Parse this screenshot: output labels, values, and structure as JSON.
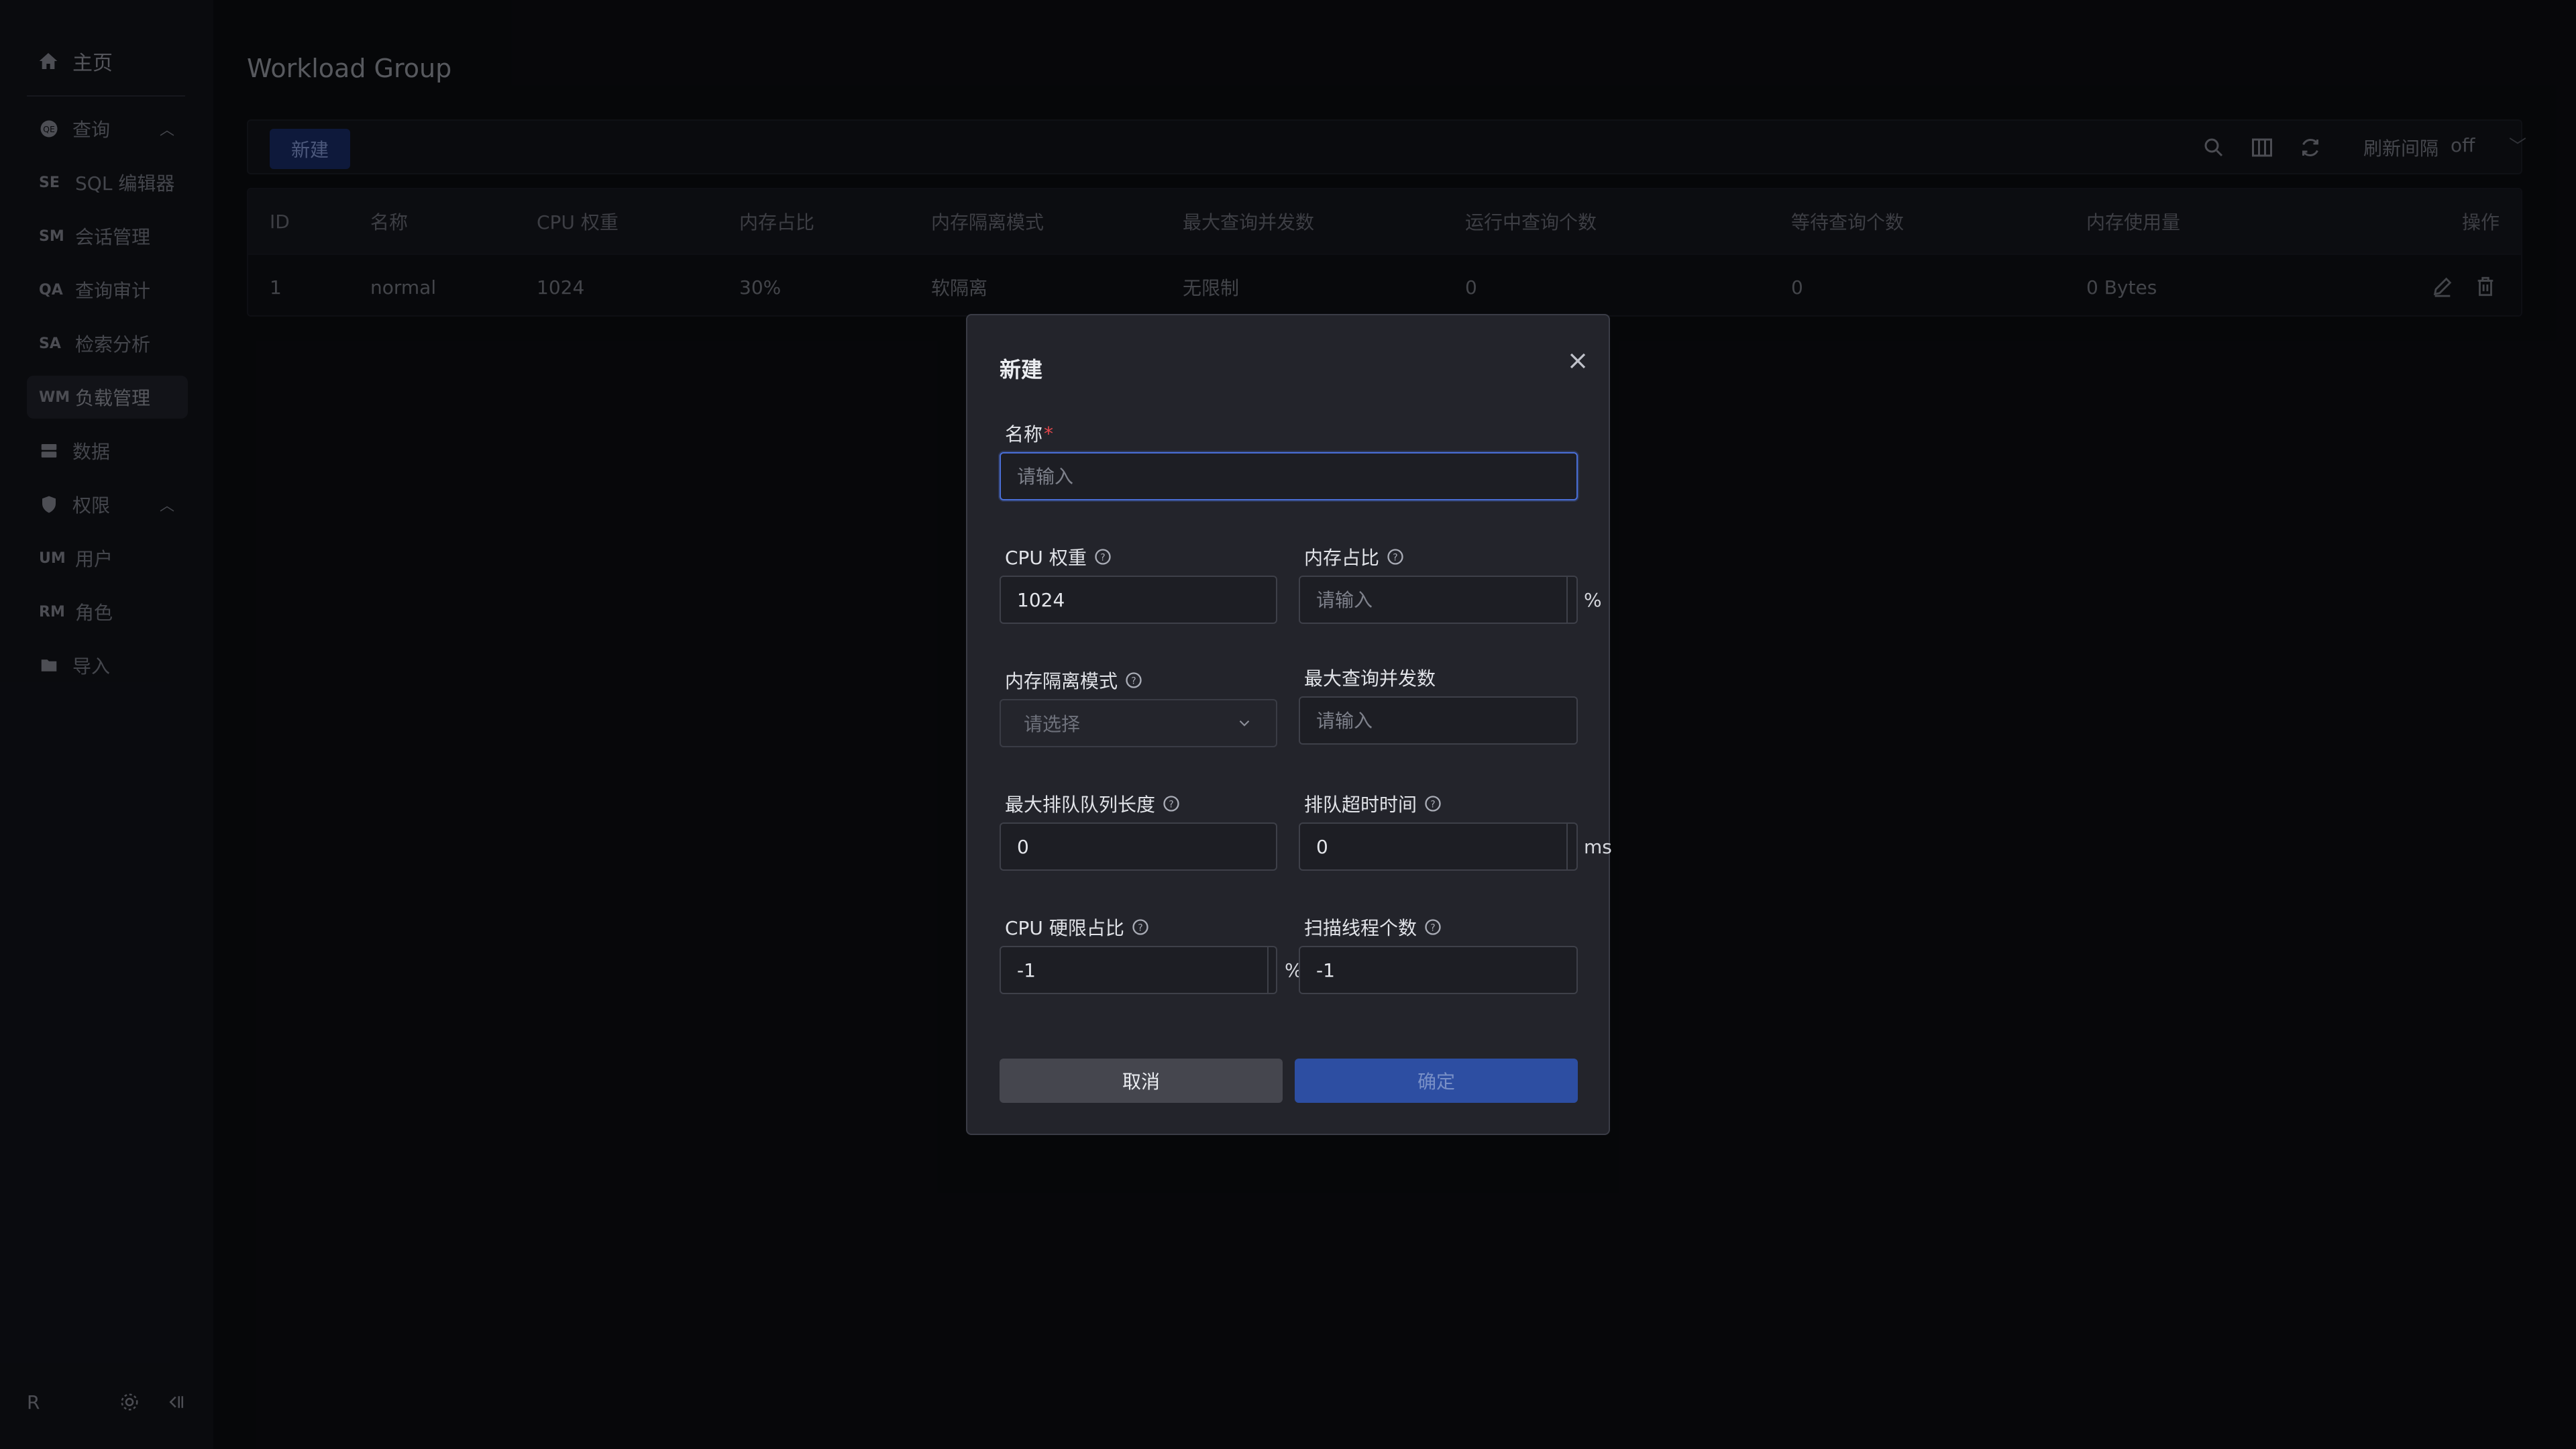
{
  "sidebar": {
    "home": "主页",
    "query_group": "查询",
    "items": [
      {
        "abbr": "SE",
        "label": "SQL 编辑器"
      },
      {
        "abbr": "SM",
        "label": "会话管理"
      },
      {
        "abbr": "QA",
        "label": "查询审计"
      },
      {
        "abbr": "SA",
        "label": "检索分析"
      },
      {
        "abbr": "WM",
        "label": "负载管理"
      }
    ],
    "data": "数据",
    "permission_group": "权限",
    "perm_items": [
      {
        "abbr": "UM",
        "label": "用户"
      },
      {
        "abbr": "RM",
        "label": "角色"
      }
    ],
    "import": "导入",
    "footer_badge": "R"
  },
  "page": {
    "title": "Workload Group",
    "new_button": "新建",
    "refresh_label": "刷新间隔",
    "refresh_value": "off"
  },
  "table": {
    "headers": [
      "ID",
      "名称",
      "CPU 权重",
      "内存占比",
      "内存隔离模式",
      "最大查询并发数",
      "运行中查询个数",
      "等待查询个数",
      "内存使用量",
      "操作"
    ],
    "rows": [
      [
        "1",
        "normal",
        "1024",
        "30%",
        "软隔离",
        "无限制",
        "0",
        "0",
        "0 Bytes"
      ]
    ]
  },
  "modal": {
    "title": "新建",
    "name_label": "名称",
    "required_mark": "*",
    "name_placeholder": "请输入",
    "cpu_weight_label": "CPU 权重",
    "cpu_weight_value": "1024",
    "memory_ratio_label": "内存占比",
    "memory_ratio_placeholder": "请输入",
    "percent_suffix": "%",
    "memory_mode_label": "内存隔离模式",
    "memory_mode_placeholder": "请选择",
    "max_concurrency_label": "最大查询并发数",
    "max_concurrency_placeholder": "请输入",
    "max_queue_label": "最大排队队列长度",
    "max_queue_value": "0",
    "queue_timeout_label": "排队超时时间",
    "queue_timeout_value": "0",
    "ms_suffix": "ms",
    "cpu_hard_label": "CPU 硬限占比",
    "cpu_hard_value": "-1",
    "scan_threads_label": "扫描线程个数",
    "scan_threads_value": "-1",
    "cancel": "取消",
    "confirm": "确定"
  }
}
